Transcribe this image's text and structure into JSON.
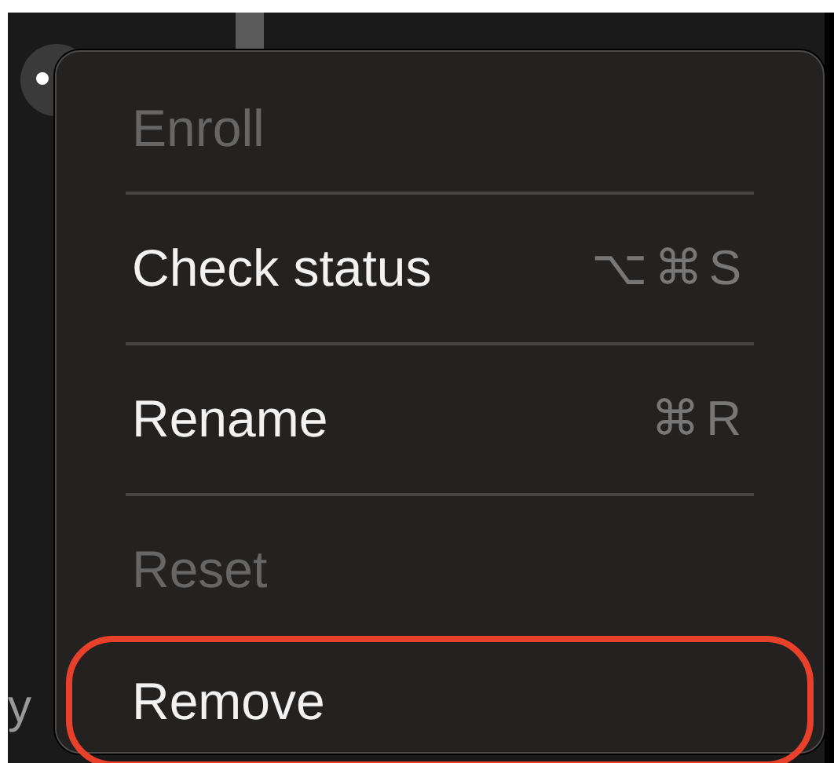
{
  "background": {
    "partial_text": "y"
  },
  "menu": {
    "items": [
      {
        "kind": "item",
        "label": "Enroll",
        "disabled": true,
        "highlighted": false
      },
      {
        "kind": "separator"
      },
      {
        "kind": "item",
        "label": "Check status",
        "shortcut": "⌥⌘S",
        "disabled": false,
        "highlighted": false
      },
      {
        "kind": "separator"
      },
      {
        "kind": "item",
        "label": "Rename",
        "shortcut": "⌘R",
        "disabled": false,
        "highlighted": false
      },
      {
        "kind": "separator"
      },
      {
        "kind": "item",
        "label": "Reset",
        "disabled": true,
        "highlighted": false
      },
      {
        "kind": "item",
        "label": "Remove",
        "disabled": false,
        "highlighted": true
      }
    ]
  }
}
